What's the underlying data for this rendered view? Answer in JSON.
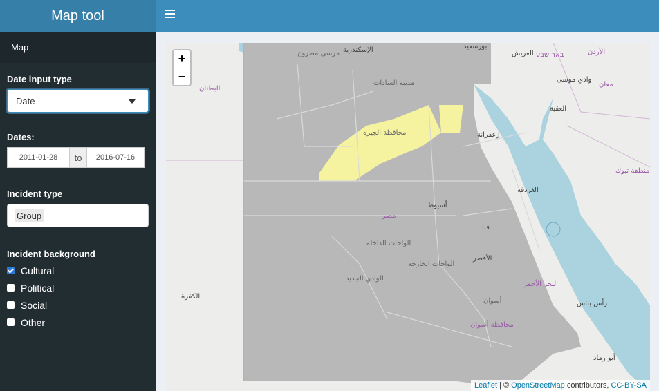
{
  "app": {
    "title": "Map tool"
  },
  "sidebar": {
    "menu_item": "Map",
    "date_input_label": "Date input type",
    "date_input_value": "Date",
    "dates_label": "Dates:",
    "date_from": "2011-01-28",
    "date_sep": "to",
    "date_to": "2016-07-16",
    "incident_type_label": "Incident type",
    "incident_type_tag": "Group",
    "background_label": "Incident background",
    "backgrounds": [
      {
        "label": "Cultural",
        "checked": true
      },
      {
        "label": "Political",
        "checked": false
      },
      {
        "label": "Social",
        "checked": false
      },
      {
        "label": "Other",
        "checked": false
      }
    ]
  },
  "map": {
    "zoom_in": "+",
    "zoom_out": "−",
    "attribution": {
      "leaflet": "Leaflet",
      "sep": " | © ",
      "osm": "OpenStreetMap",
      "contrib": " contributors, ",
      "license": "CC-BY-SA"
    },
    "labels": {
      "alex": "الإسكندرية",
      "portsaid": "بورسعيد",
      "arish": "العريش",
      "beersheba": "באר שבע",
      "jordan": "الأردن",
      "matruh": "مرسى مطروح",
      "sadat": "مدينة السادات",
      "wadimusa": "وادي موسى",
      "maan": "معان",
      "aqaba": "العقبة",
      "batnan": "البطنان",
      "giza": "محافظة الجيزة",
      "zafarana": "زعفرانة",
      "tabuk": "منطقة تبوك",
      "hurghada": "الغردقة",
      "misr": "مصر",
      "dakhla": "الواحات الداخلة",
      "kharga": "الواحات الخارجة",
      "newvalley": "الوادي الجديد",
      "redsea": "البحر الأحمر",
      "kufra": "الكفرة",
      "aswan": "أسوان",
      "aswangov": "محافظة أسوان",
      "rasbanas": "رأس بناس",
      "aburamad": "أبو رماد",
      "luxor": "الأقصر",
      "qena": "قنا",
      "asyut": "أسيوط"
    }
  },
  "colors": {
    "header": "#3c8dbc",
    "logo": "#367fa9",
    "sidebar": "#222d32",
    "sea": "#aad3df",
    "region": "#b8b8b8",
    "highlight": "#f5f2a0"
  }
}
